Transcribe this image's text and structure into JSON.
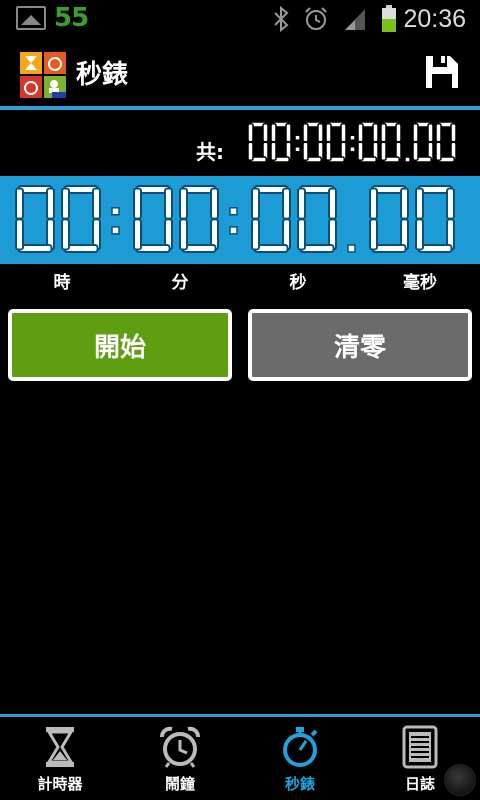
{
  "status_bar": {
    "battery_level_text": "55",
    "time": "20:36",
    "icons": [
      "gallery-icon",
      "bluetooth-icon",
      "alarm-icon",
      "signal-icon",
      "battery-charging-icon"
    ]
  },
  "action_bar": {
    "title": "秒錶",
    "logo_icon": "app-logo-icon",
    "save_icon": "save-icon"
  },
  "total": {
    "label": "共:",
    "value": "00:00:00.00"
  },
  "timer": {
    "hours": "00",
    "minutes": "00",
    "seconds": "00",
    "centiseconds": "00",
    "separator_colon": ":",
    "separator_dot": ".",
    "units": {
      "hours": "時",
      "minutes": "分",
      "seconds": "秒",
      "centiseconds": "毫秒"
    }
  },
  "buttons": {
    "start": "開始",
    "reset": "清零"
  },
  "colors": {
    "accent": "#1c9bd4",
    "start": "#5f9e10",
    "reset": "#6b6b6b",
    "battery_text": "#3aa12e"
  },
  "tabs": [
    {
      "label": "計時器",
      "icon": "hourglass-icon",
      "active": false
    },
    {
      "label": "鬧鐘",
      "icon": "alarm-clock-icon",
      "active": false
    },
    {
      "label": "秒錶",
      "icon": "stopwatch-icon",
      "active": true
    },
    {
      "label": "日誌",
      "icon": "log-icon",
      "active": false
    }
  ]
}
